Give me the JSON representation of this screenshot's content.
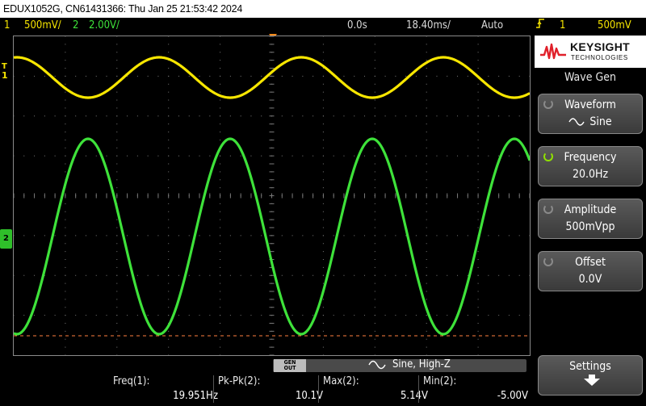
{
  "window": {
    "title": "EDUX1052G, CN61431366: Thu Jan 25 21:53:42 2024"
  },
  "status": {
    "ch1_num": "1",
    "ch1_scale": "500mV/",
    "ch2_num": "2",
    "ch2_scale": "2.00V/",
    "time_delay": "0.0s",
    "time_scale": "18.40ms/",
    "trigger_mode": "Auto",
    "trigger_source": "1",
    "trigger_level": "500mV",
    "trigger_edge_icon": "rising-edge-icon"
  },
  "screen": {
    "ch1_marker": "1",
    "ch2_marker": "2",
    "ch1_trigger_t": "T",
    "colors": {
      "ch1": "#f7e600",
      "ch2": "#3ee23a",
      "grid": "#7a7a7a",
      "ref": "#ff8040"
    }
  },
  "panel": {
    "brand": "KEYSIGHT",
    "brand_sub": "TECHNOLOGIES",
    "menu_title": "Wave Gen",
    "keys": [
      {
        "label": "Waveform",
        "value": "Sine"
      },
      {
        "label": "Frequency",
        "value": "20.0Hz"
      },
      {
        "label": "Amplitude",
        "value": "500mVpp"
      },
      {
        "label": "Offset",
        "value": "0.0V"
      },
      {
        "label": "Settings"
      }
    ]
  },
  "bottom": {
    "gen_out": [
      "GEN",
      "OUT"
    ],
    "wavegen_status": "Sine, High-Z",
    "measurements": [
      {
        "label": "Freq(1):",
        "value": "19.951Hz"
      },
      {
        "label": "Pk-Pk(2):",
        "value": "10.1V"
      },
      {
        "label": "Max(2):",
        "value": "5.14V"
      },
      {
        "label": "Min(2):",
        "value": "-5.00V"
      }
    ]
  }
}
